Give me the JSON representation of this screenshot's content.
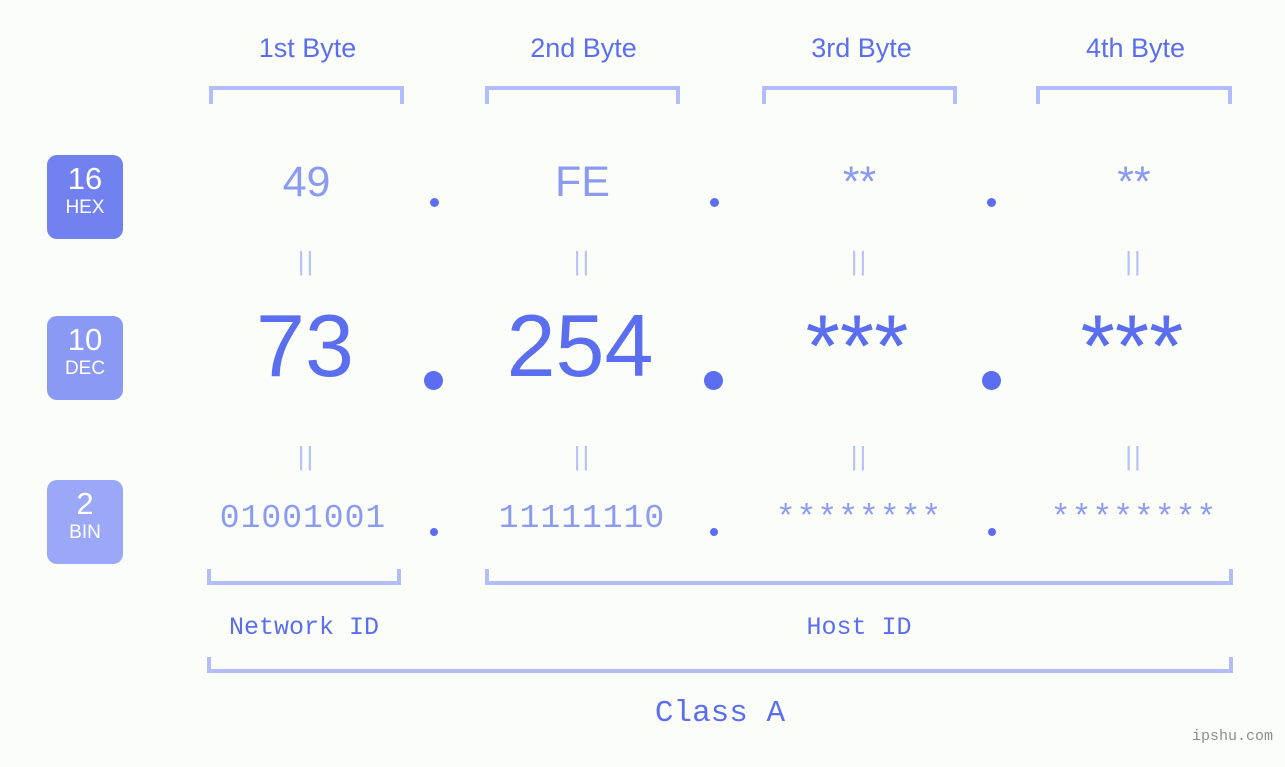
{
  "page": {
    "background_color": "#fbfdf8",
    "accent_color": "#5b6ef0",
    "accent_light_color": "#8c9bf2",
    "bracket_color": "#b3bdfb",
    "watermark": "ipshu.com"
  },
  "byte_headers": [
    {
      "label": "1st Byte"
    },
    {
      "label": "2nd Byte"
    },
    {
      "label": "3rd Byte"
    },
    {
      "label": "4th Byte"
    }
  ],
  "bases": [
    {
      "number": "16",
      "abbr": "HEX",
      "color": "#7182f0"
    },
    {
      "number": "10",
      "abbr": "DEC",
      "color": "#8a99f4"
    },
    {
      "number": "2",
      "abbr": "BIN",
      "color": "#9aa8f7"
    }
  ],
  "rows": {
    "hex": {
      "base_number": "16",
      "base_abbr": "HEX",
      "values": [
        "49",
        "FE",
        "**",
        "**"
      ],
      "separator": "."
    },
    "dec": {
      "base_number": "10",
      "base_abbr": "DEC",
      "values": [
        "73",
        "254",
        "***",
        "***"
      ],
      "separator": "."
    },
    "bin": {
      "base_number": "2",
      "base_abbr": "BIN",
      "values": [
        "01001001",
        "11111110",
        "********",
        "********"
      ],
      "separator": "."
    }
  },
  "equals_marks": {
    "symbol": "||",
    "count_per_row": 4
  },
  "segments": {
    "network_id": "Network ID",
    "host_id": "Host ID",
    "class": "Class A"
  }
}
